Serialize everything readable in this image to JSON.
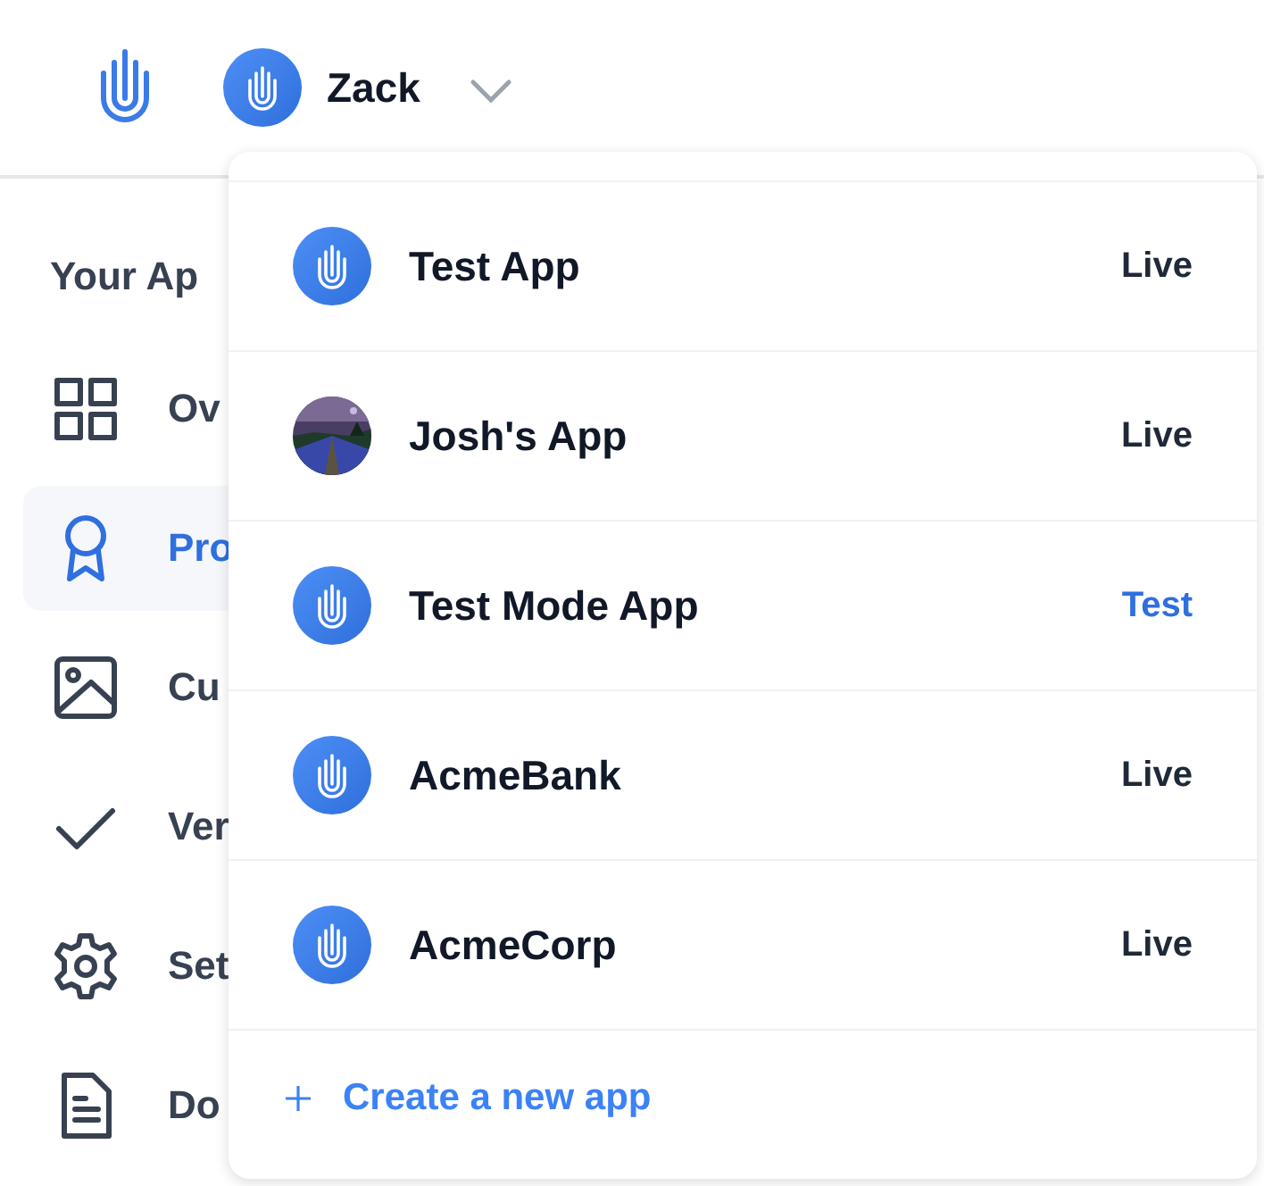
{
  "header": {
    "user_name": "Zack"
  },
  "sidebar": {
    "title": "Your Ap",
    "items": [
      {
        "label": "Ov",
        "selected": false
      },
      {
        "label": "Pro",
        "selected": true
      },
      {
        "label": "Cu",
        "selected": false
      },
      {
        "label": "Ver",
        "selected": false
      },
      {
        "label": "Set",
        "selected": false
      },
      {
        "label": "Do",
        "selected": false
      }
    ]
  },
  "app_menu": {
    "apps": [
      {
        "name": "Test App",
        "kind": "logo",
        "color": "#1f2937",
        "status": "Live"
      },
      {
        "name": "Josh's App",
        "kind": "picture",
        "color": "#1f2937",
        "status": "Live"
      },
      {
        "name": "Test Mode App",
        "kind": "logo",
        "color": "#2f6fe0",
        "status": "Test"
      },
      {
        "name": "AcmeBank",
        "kind": "logo",
        "color": "#1f2937",
        "status": "Live"
      },
      {
        "name": "AcmeCorp",
        "kind": "logo",
        "color": "#1f2937",
        "status": "Live"
      }
    ],
    "create_label": "Create a new app"
  }
}
